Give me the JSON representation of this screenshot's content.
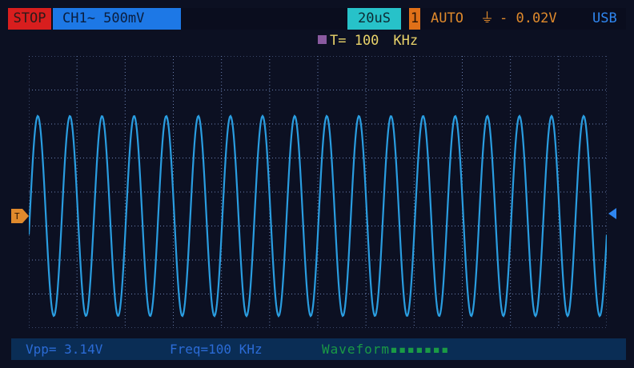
{
  "status_bar": {
    "run_state": "STOP",
    "channel": "CH1~ 500mV",
    "timebase": "20uS",
    "trigger_channel": "1",
    "trigger_mode": "AUTO",
    "trigger_edge_symbol": "⏚",
    "trigger_level": "- 0.02V",
    "connection": "USB"
  },
  "frequency_header": {
    "label": "T= 100",
    "unit": "KHz"
  },
  "measurements": {
    "vpp": "Vpp=  3.14V",
    "freq": "Freq=100  KHz",
    "extra": "Waveform▪▪▪▪▪▪▪"
  },
  "waveform": {
    "type": "line",
    "frequency_khz": 100,
    "timebase_per_div_us": 20,
    "vpp_volts": 3.14,
    "visible_cycles": 18,
    "color": "#2a9de0"
  },
  "colors": {
    "stop_bg": "#d81e1e",
    "channel_bg": "#1d78e6",
    "timebase_bg": "#27c2c9",
    "trigger_ch_bg": "#e07018",
    "trigger_text": "#e08a2c",
    "usb_text": "#2f86f0",
    "freq_header_text": "#e9d36a",
    "grid_color": "#6a80b0",
    "trace_color": "#2a9de0"
  }
}
